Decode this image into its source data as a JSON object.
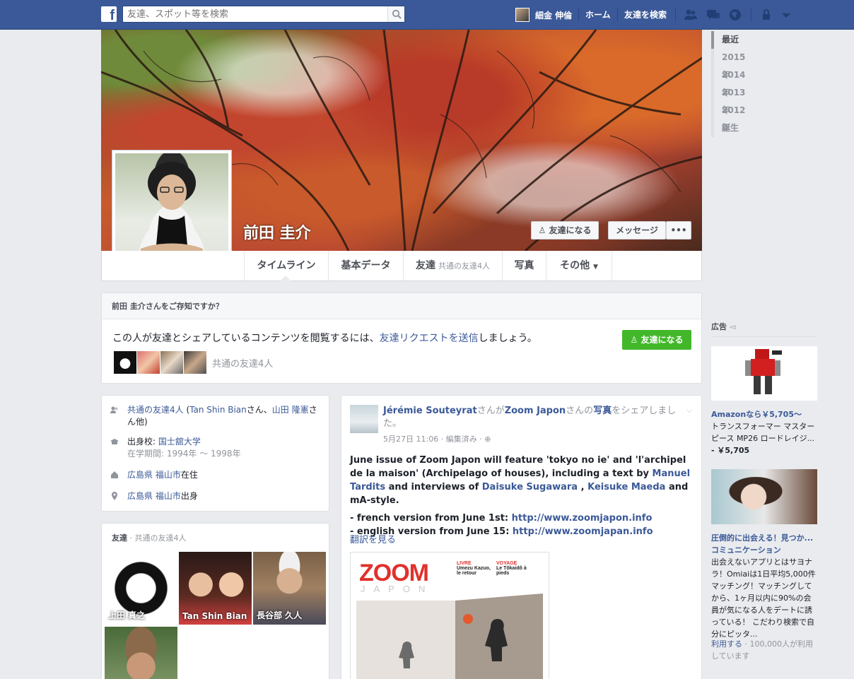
{
  "topbar": {
    "logo": "f",
    "search_placeholder": "友達、スポット等を検索",
    "user_name": "細金 伸倫",
    "home": "ホーム",
    "find_friends": "友達を検索",
    "icons": [
      "friend-requests-icon",
      "messages-icon",
      "notifications-icon",
      "privacy-shortcuts-icon",
      "account-menu-icon"
    ]
  },
  "profile": {
    "name": "前田 圭介",
    "add_friend": "友達になる",
    "message": "メッセージ",
    "more": "•••"
  },
  "tabs": [
    {
      "label": "タイムライン"
    },
    {
      "label": "基本データ"
    },
    {
      "label": "友達",
      "sub": "共通の友達4人"
    },
    {
      "label": "写真"
    },
    {
      "label": "その他"
    }
  ],
  "years": [
    "最近",
    "2015年",
    "2014年",
    "2013年",
    "2012年",
    "誕生"
  ],
  "know": {
    "title": "前田 圭介さんをご存知ですか？",
    "text_before": "この人が友達とシェアしているコンテンツを閲覧するには、",
    "text_link": "友達リクエストを送信",
    "text_after": "しましょう。",
    "button": "友達になる",
    "mutual": "共通の友達4人"
  },
  "intro": {
    "mutual_link": "共通の友達4人",
    "mutual_mid": " (",
    "mutual_name1": "Tan Shin Bian",
    "mutual_san": "さん、",
    "mutual_name2": "山田 隆憲",
    "mutual_tail": "さん他)",
    "school_label": "出身校: ",
    "school": "国士舘大学",
    "school_years": "在学期間: 1994年 〜 1998年",
    "live_pref": "広島県",
    "live_city": "福山市",
    "live_suffix": "在住",
    "from_pref": "広島県",
    "from_city": "福山市",
    "from_suffix": "出身"
  },
  "friends": {
    "title": "友達",
    "sub": " · 共通の友達4人",
    "items": [
      {
        "name": "上田 真之"
      },
      {
        "name": "Tan Shin Bian"
      },
      {
        "name": "長谷部 久人"
      },
      {
        "name": ""
      }
    ]
  },
  "post": {
    "author": "Jérémie Souteyrat",
    "mid": "さんが",
    "page": "Zoom Japon",
    "mid2": "さんの",
    "photo": "写真",
    "tail": "をシェアしました。",
    "date": "5月27日 11:06",
    "edited": " · 編集済み · ",
    "line1_a": "June issue of Zoom Japon will feature 'tokyo no ie' and 'l'archipel de la maison' (Archipelago of houses), including a text by ",
    "line1_link1": "Manuel Tardits",
    "line1_b": " and interviews of ",
    "line1_link2": "Daisuke Sugawara",
    "line1_c": " , ",
    "line1_link3": "Keisuke Maeda",
    "line1_d": " and mA-style.",
    "line2_a": "- french version from June 1st: ",
    "line2_link": "http://www.zoomjapon.info",
    "line3_a": "- english version from June 15: ",
    "line3_link": "http://www.zoomjapan.info",
    "translate": "翻訳を見る",
    "mag_title": "ZOOM",
    "mag_sub": "JAPON",
    "mag_tag1": "LIVRE",
    "mag_tag1_text": "Umezu Kazuo, le retour",
    "mag_tag2": "VOYAGE",
    "mag_tag2_text": "Le Tôkaidô à pieds"
  },
  "ads": {
    "header": "広告",
    "ad1_title": "Amazonなら￥5,705〜",
    "ad1_text": "トランスフォーマー マスターピース MP26 ロードレイジ...",
    "ad1_price": "- ￥5,705",
    "ad2_title": "圧倒的に出会える！見つか... コミュニケーション",
    "ad2_text": "出会えないアプリとはサヨナラ！Omiaiは1日平均5,000件マッチング！マッチングしてから、1ヶ月以内に90%の会員が気になる人をデートに誘っている！ こだわり検索で自分にピッタ...",
    "ad2_use": "利用する",
    "ad2_count": " · 100,000人が利用しています"
  },
  "colors": {
    "brand": "#3b5998",
    "green": "#42b72a",
    "background": "#e9ebee"
  }
}
